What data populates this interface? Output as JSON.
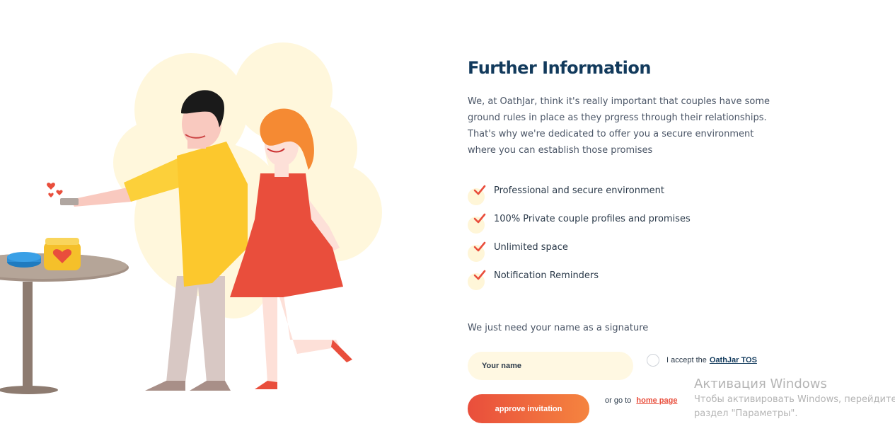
{
  "colors": {
    "title": "#123a5c",
    "accent": "#e94e3c",
    "accent_end": "#f5843f",
    "input_bg": "#fff8e2"
  },
  "content": {
    "title": "Further Information",
    "intro": "We, at OathJar, think it's really important that couples have some ground rules in place as they prgress through their relationships. That's why we're dedicated to offer you a secure environment where you can establish those promises"
  },
  "features": [
    {
      "label": "Professional and secure environment",
      "icon": "check-icon"
    },
    {
      "label": "100% Private couple profiles and promises",
      "icon": "check-icon"
    },
    {
      "label": "Unlimited space",
      "icon": "check-icon"
    },
    {
      "label": "Notification Reminders",
      "icon": "check-icon"
    }
  ],
  "form": {
    "signature_label": "We just need your name as a signature",
    "name_placeholder": "Your name",
    "name_value": "",
    "tos_prefix": "I accept the",
    "tos_link": "OathJar TOS",
    "tos_checked": false,
    "approve_label": "approve invitation",
    "goto_prefix": "or go to",
    "goto_link": "home page"
  },
  "watermark": {
    "title": "Активация Windows",
    "line1": "Чтобы активировать Windows, перейдите в",
    "line2": "раздел \"Параметры\"."
  }
}
